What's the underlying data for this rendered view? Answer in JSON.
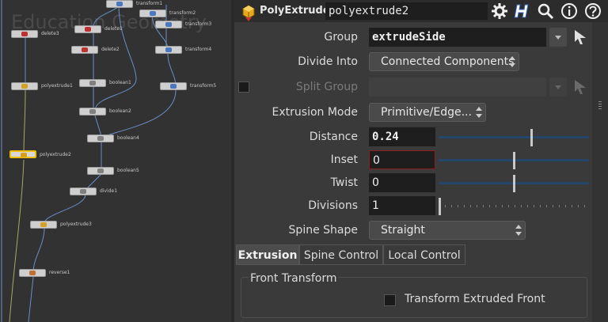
{
  "network": {
    "watermark": "Education Geometry",
    "nodes": [
      {
        "label": "transform1",
        "color": "#4a78c0"
      },
      {
        "label": "transform2",
        "color": "#4a78c0"
      },
      {
        "label": "delete3",
        "color": "#c03030"
      },
      {
        "label": "delete1",
        "color": "#c03030"
      },
      {
        "label": "transform3",
        "color": "#4a78c0"
      },
      {
        "label": "delete2",
        "color": "#c03030"
      },
      {
        "label": "transform4",
        "color": "#4a78c0"
      },
      {
        "label": "polyextrude1",
        "color": "#d4a020"
      },
      {
        "label": "boolean1",
        "color": "#808080"
      },
      {
        "label": "transform5",
        "color": "#4a78c0"
      },
      {
        "label": "boolean2",
        "color": "#808080"
      },
      {
        "label": "polyextrude2",
        "color": "#d4a020"
      },
      {
        "label": "boolean4",
        "color": "#808080"
      },
      {
        "label": "boolean5",
        "color": "#808080"
      },
      {
        "label": "divide1",
        "color": "#808080"
      },
      {
        "label": "polyextrude3",
        "color": "#d4a020"
      },
      {
        "label": "reverse1",
        "color": "#c07030"
      }
    ]
  },
  "header": {
    "node_type": "PolyExtrude",
    "node_name": "polyextrude2",
    "icons": [
      "gear-icon",
      "help-h-icon",
      "search-icon",
      "info-icon",
      "help-icon"
    ]
  },
  "params": {
    "group": {
      "label": "Group",
      "value": "extrudeSide"
    },
    "divide_into": {
      "label": "Divide Into",
      "value": "Connected Components"
    },
    "split_group": {
      "label": "Split Group",
      "value": ""
    },
    "extrusion_mode": {
      "label": "Extrusion Mode",
      "value": "Primitive/Edge..."
    },
    "distance": {
      "label": "Distance",
      "value": "0.24",
      "fraction": 0.62
    },
    "inset": {
      "label": "Inset",
      "value": "0",
      "fraction": 0.5
    },
    "twist": {
      "label": "Twist",
      "value": "0",
      "fraction": 0.5
    },
    "divisions": {
      "label": "Divisions",
      "value": "1",
      "fraction": 0.0
    },
    "spine_shape": {
      "label": "Spine Shape",
      "value": "Straight"
    }
  },
  "tabs": [
    {
      "label": "Extrusion",
      "active": true
    },
    {
      "label": "Spine Control",
      "active": false
    },
    {
      "label": "Local Control",
      "active": false
    }
  ],
  "front_transform": {
    "title": "Front Transform",
    "checkbox_label": "Transform Extruded Front",
    "checked": false
  },
  "colors": {
    "selected_node": "#f0c000",
    "slider_track": "#25466b",
    "field_bg": "#1e1e1e"
  }
}
